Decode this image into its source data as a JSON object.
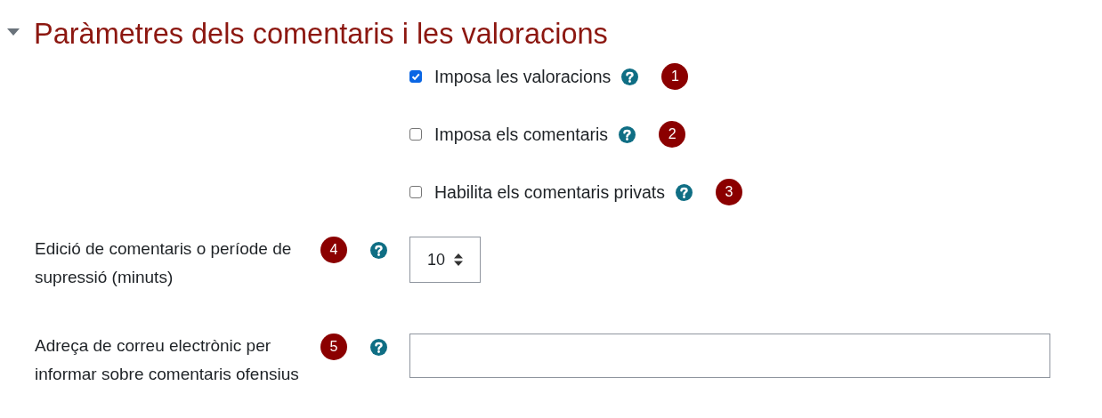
{
  "section": {
    "title": "Paràmetres dels comentaris i les valoracions",
    "expanded": true
  },
  "fields": [
    {
      "kind": "checkbox",
      "label": "Imposa les valoracions",
      "checked": true,
      "badge": "1"
    },
    {
      "kind": "checkbox",
      "label": "Imposa els comentaris",
      "checked": false,
      "badge": "2"
    },
    {
      "kind": "checkbox",
      "label": "Habilita els comentaris privats",
      "checked": false,
      "badge": "3"
    },
    {
      "kind": "select",
      "label": "Edició de comentaris o període de supressió (minuts)",
      "value": "10",
      "badge": "4"
    },
    {
      "kind": "text",
      "label": "Adreça de correu electrònic per informar sobre comentaris ofensius",
      "badge": "5"
    }
  ]
}
